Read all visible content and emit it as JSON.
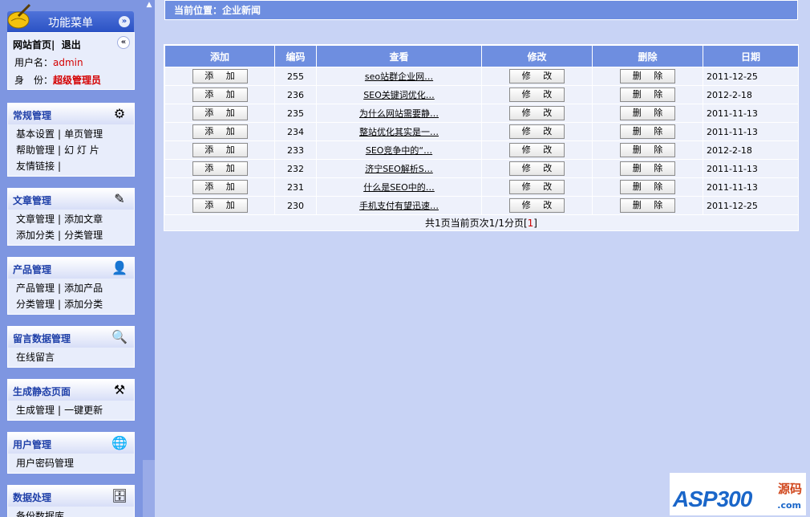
{
  "sidebar": {
    "menu_title": "功能菜单",
    "nav": {
      "home": "网站首页",
      "sep": "|",
      "logout": "退出"
    },
    "user": {
      "name_label": "用户名：",
      "name_value": "admin",
      "role_label": "身　份：",
      "role_value": "超级管理员"
    },
    "groups": [
      {
        "title": "常规管理",
        "icon": "gear-network-icon",
        "lines": [
          [
            "基本设置",
            "单页管理"
          ],
          [
            "帮助管理",
            "幻 灯 片"
          ],
          [
            "友情链接",
            ""
          ]
        ]
      },
      {
        "title": "文章管理",
        "icon": "edit-doc-icon",
        "lines": [
          [
            "文章管理",
            "添加文章"
          ],
          [
            "添加分类",
            "分类管理"
          ]
        ]
      },
      {
        "title": "产品管理",
        "icon": "user-product-icon",
        "lines": [
          [
            "产品管理",
            "添加产品"
          ],
          [
            "分类管理",
            "添加分类"
          ]
        ]
      },
      {
        "title": "留言数据管理",
        "icon": "search-icon",
        "lines": [
          [
            "在线留言"
          ]
        ]
      },
      {
        "title": "生成静态页面",
        "icon": "hammer-icon",
        "lines": [
          [
            "生成管理",
            "一键更新"
          ]
        ]
      },
      {
        "title": "用户管理",
        "icon": "globe-icon",
        "lines": [
          [
            "用户密码管理"
          ]
        ]
      },
      {
        "title": "数据处理",
        "icon": "database-icon",
        "lines": [
          [
            "备份数据库"
          ]
        ]
      }
    ]
  },
  "breadcrumb": "当前位置：企业新闻",
  "table": {
    "headers": [
      "添加",
      "编码",
      "查看",
      "修改",
      "删除",
      "日期"
    ],
    "add_label": "添 加",
    "edit_label": "修 改",
    "delete_label": "删 除",
    "rows": [
      {
        "id": "255",
        "title": "seo站群企业网…",
        "date": "2011-12-25"
      },
      {
        "id": "236",
        "title": "SEO关键词优化…",
        "date": "2012-2-18"
      },
      {
        "id": "235",
        "title": "为什么网站需要静…",
        "date": "2011-11-13"
      },
      {
        "id": "234",
        "title": "整站优化其实是一…",
        "date": "2011-11-13"
      },
      {
        "id": "233",
        "title": "SEO竞争中的“…",
        "date": "2012-2-18"
      },
      {
        "id": "232",
        "title": "济宁SEO解析S…",
        "date": "2011-11-13"
      },
      {
        "id": "231",
        "title": "什么是SEO中的…",
        "date": "2011-11-13"
      },
      {
        "id": "230",
        "title": "手机支付有望迅速…",
        "date": "2011-12-25"
      }
    ]
  },
  "pager": {
    "text": "共1页当前页次1/1分页[",
    "current": "1",
    "close": "]"
  },
  "watermark": {
    "main": "ASP300",
    "sub": "源码",
    "com": ".com"
  }
}
